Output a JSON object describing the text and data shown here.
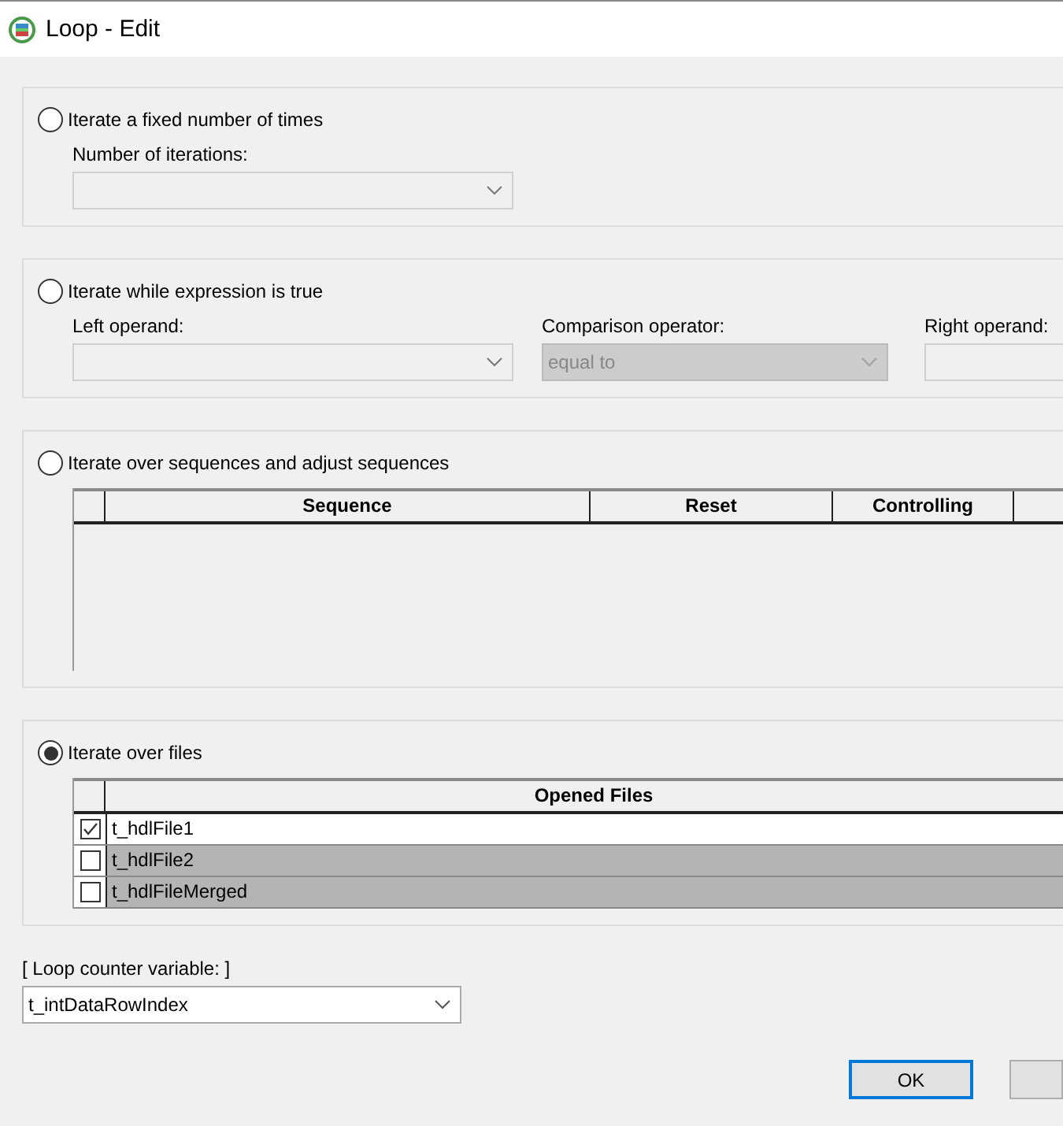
{
  "window": {
    "title": "Loop - Edit"
  },
  "options": [
    {
      "kind": "fixed",
      "label": "Iterate a fixed number of times",
      "selected": false,
      "fields": [
        {
          "label": "Number of iterations:",
          "disabled": false
        }
      ]
    },
    {
      "kind": "while",
      "label": "Iterate while expression is true",
      "selected": false,
      "fields": [
        {
          "label": "Left operand:",
          "disabled": false
        },
        {
          "label": "Comparison operator:",
          "value": "equal to",
          "disabled": true
        },
        {
          "label": "Right operand:",
          "disabled": false
        }
      ]
    },
    {
      "kind": "sequences",
      "label": "Iterate over sequences and adjust sequences",
      "selected": false,
      "columns": [
        "Sequence",
        "Reset",
        "Controlling"
      ]
    },
    {
      "kind": "files",
      "label": "Iterate over files",
      "selected": true,
      "columns": [
        "Opened Files"
      ],
      "rows": [
        {
          "name": "t_hdlFile1",
          "checked": true,
          "selected": false
        },
        {
          "name": "t_hdlFile2",
          "checked": false,
          "selected": true
        },
        {
          "name": "t_hdlFileMerged",
          "checked": false,
          "selected": true
        }
      ]
    }
  ],
  "counter": {
    "label": "[ Loop counter variable: ]",
    "value": "t_intDataRowIndex"
  },
  "buttons": [
    "OK"
  ]
}
